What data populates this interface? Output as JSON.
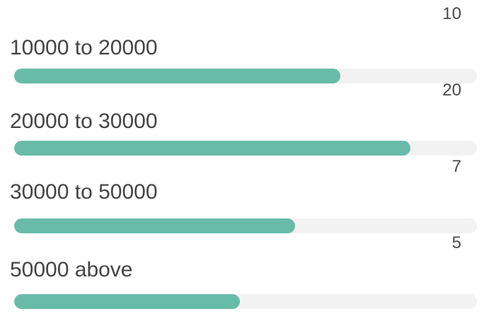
{
  "colors": {
    "bar_fill": "#69bba9",
    "bar_track": "#f2f2f2",
    "text": "#444444"
  },
  "bars": [
    {
      "label": "10000 to 20000",
      "count": "10",
      "fill_fraction": 0.705
    },
    {
      "label": "20000 to 30000",
      "count": "20",
      "fill_fraction": 0.857
    },
    {
      "label": "30000 to 50000",
      "count": "7",
      "fill_fraction": 0.607
    },
    {
      "label": "50000 above",
      "count": "5",
      "fill_fraction": 0.488
    }
  ]
}
